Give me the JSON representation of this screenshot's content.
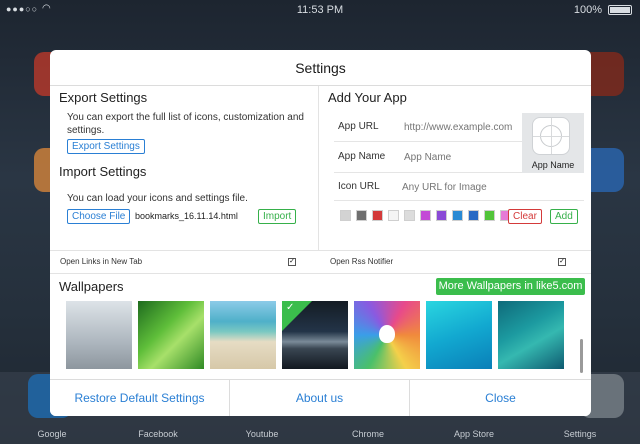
{
  "status_bar": {
    "time": "11:53 PM",
    "battery": "100%"
  },
  "background_apps": [
    {
      "label": "Google",
      "color": "#1d6fb8"
    },
    {
      "label": "Facebook",
      "color": "#3a5a98"
    },
    {
      "label": "Youtube",
      "color": "#c33"
    },
    {
      "label": "Chrome",
      "color": "#5a6a78"
    },
    {
      "label": "App Store",
      "color": "#1b7fd6"
    },
    {
      "label": "Settings",
      "color": "#7d858c"
    }
  ],
  "dialog": {
    "title": "Settings",
    "export": {
      "heading": "Export Settings",
      "description": "You can export the full list of icons, customization and settings.",
      "button": "Export Settings"
    },
    "import": {
      "heading": "Import Settings",
      "description": "You can load your icons and settings file.",
      "choose_button": "Choose File",
      "file_name": "bookmarks_16.11.14.html",
      "import_button": "Import"
    },
    "add_app": {
      "heading": "Add Your App",
      "app_url_label": "App URL",
      "app_url_placeholder": "http://www.example.com",
      "app_name_label": "App Name",
      "app_name_placeholder": "App Name",
      "icon_url_label": "Icon URL",
      "icon_url_placeholder": "Any URL for Image",
      "preview_label": "App Name",
      "swatch_colors": [
        "#d3d3d3",
        "#6e6e6e",
        "#d33a3a",
        "#f4f4f4",
        "#dcdcdc",
        "#c34ad6",
        "#8a4ad6",
        "#2a8ad4",
        "#2a6ac4",
        "#52c43a",
        "#e67ad6"
      ],
      "clear_button": "Clear",
      "add_button": "Add"
    },
    "options": {
      "open_links_label": "Open Links in New Tab",
      "open_links_checked": true,
      "open_rss_label": "Open Rss Notifier",
      "open_rss_checked": true
    },
    "wallpapers": {
      "heading": "Wallpapers",
      "more_button": "More Wallpapers in like5.com",
      "selected_index": 3,
      "count": 7
    },
    "footer": {
      "restore": "Restore Default Settings",
      "about": "About us",
      "close": "Close"
    }
  },
  "colors": {
    "accent_blue": "#2a7fd4",
    "accent_green": "#3bbd4c",
    "danger_red": "#d43a3a"
  }
}
